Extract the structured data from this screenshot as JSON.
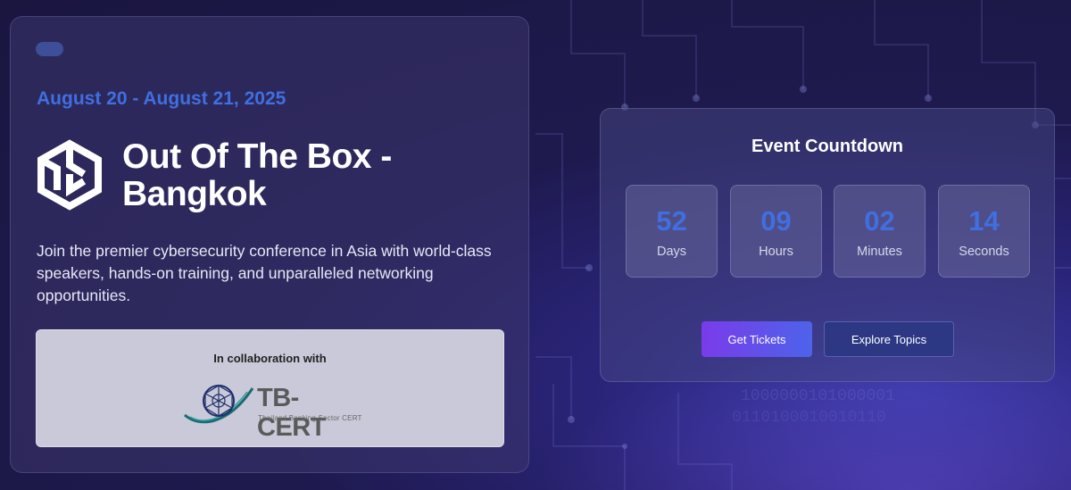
{
  "event": {
    "date_range": "August 20 - August 21, 2025",
    "title": "Out Of The Box - Bangkok",
    "description": "Join the premier cybersecurity conference in Asia with world-class speakers, hands-on training, and unparalleled networking opportunities.",
    "logo_icon": "cube-logo-icon"
  },
  "collaboration": {
    "label": "In collaboration with",
    "partner_name": "TB-CERT",
    "partner_tagline": "Thailand Banking Sector CERT"
  },
  "countdown": {
    "title": "Event Countdown",
    "units": [
      {
        "value": "52",
        "label": "Days"
      },
      {
        "value": "09",
        "label": "Hours"
      },
      {
        "value": "02",
        "label": "Minutes"
      },
      {
        "value": "14",
        "label": "Seconds"
      }
    ]
  },
  "actions": {
    "primary_label": "Get Tickets",
    "secondary_label": "Explore Topics"
  },
  "colors": {
    "accent": "#3f6fe0",
    "button_gradient_start": "#7a3bea",
    "button_gradient_end": "#4d63ea"
  }
}
